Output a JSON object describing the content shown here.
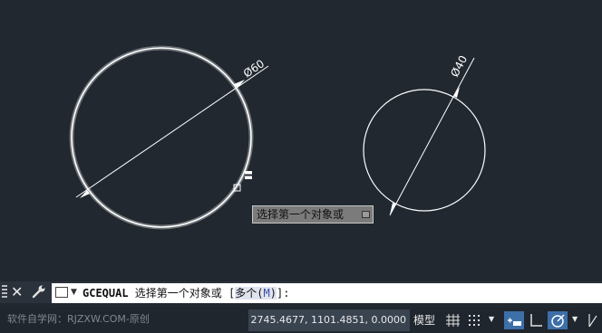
{
  "drawing": {
    "large_circle_dim": "Ø60",
    "small_circle_dim": "Ø40",
    "tooltip_text": "选择第一个对象或"
  },
  "command": {
    "name": "GCEQUAL",
    "prompt": " 选择第一个对象或 [",
    "option_label": "多个(",
    "option_key": "M",
    "option_close": ")",
    "suffix": "]:"
  },
  "status": {
    "watermark": "软件自学网：RJZXW.COM-原创",
    "coordinates": "2745.4677, 1101.4851, 0.0000",
    "model_label": "模型"
  },
  "colors": {
    "background": "#212830",
    "geometry": "#ffffff",
    "active_toggle": "#3d6fa9"
  },
  "icons": [
    "close-icon",
    "wrench-icon",
    "command-window-icon",
    "grid-icon",
    "snap-icon",
    "infer-constraints-icon",
    "ortho-icon",
    "polar-tracking-icon",
    "lineweight-icon"
  ]
}
